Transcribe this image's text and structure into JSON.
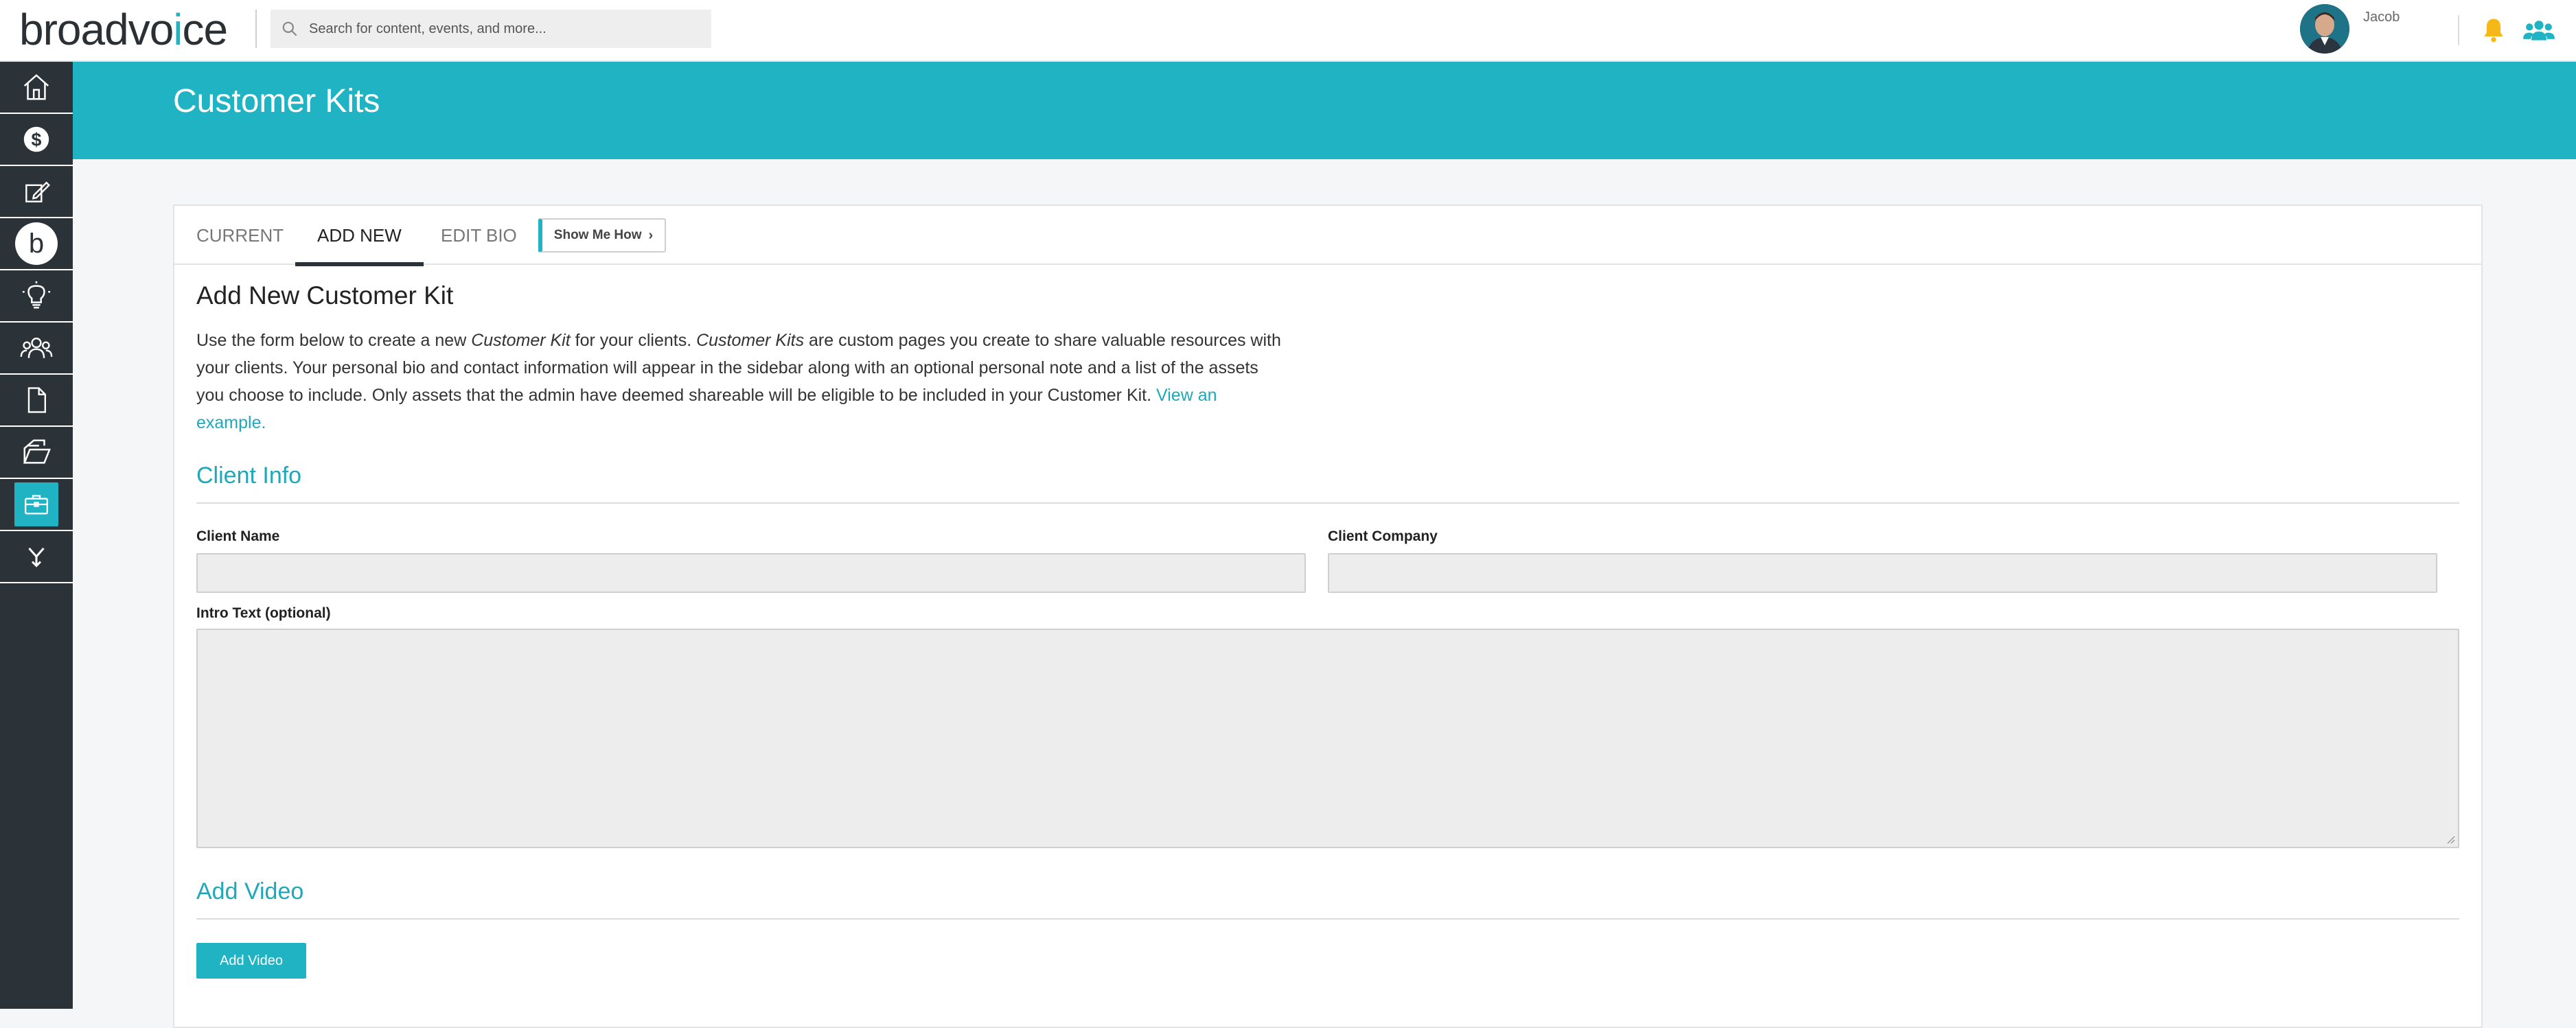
{
  "brand": {
    "logo_pre": "broadvo",
    "logo_accent": "i",
    "logo_post": "ce",
    "accent_color": "#1fb3c4",
    "sidebar_color": "#2b3238"
  },
  "search": {
    "placeholder": "Search for content, events, and more..."
  },
  "user": {
    "name": "Jacob"
  },
  "sidebar": {
    "items": [
      {
        "icon": "home-icon"
      },
      {
        "icon": "dollar-icon"
      },
      {
        "icon": "edit-icon"
      },
      {
        "icon": "b-logo-icon",
        "label": "b"
      },
      {
        "icon": "lightbulb-icon"
      },
      {
        "icon": "people-icon"
      },
      {
        "icon": "document-icon"
      },
      {
        "icon": "folder-icon"
      },
      {
        "icon": "briefcase-icon",
        "active": true
      },
      {
        "icon": "merge-icon"
      }
    ]
  },
  "page": {
    "title": "Customer Kits"
  },
  "tabs": [
    {
      "label": "CURRENT"
    },
    {
      "label": "ADD NEW",
      "active": true
    },
    {
      "label": "EDIT BIO"
    }
  ],
  "show_me_how": {
    "label": "Show Me How",
    "chevron": "›"
  },
  "form": {
    "heading": "Add New Customer Kit",
    "intro": {
      "part1": "Use the form below to create a new ",
      "em1": "Customer Kit",
      "part2": " for your clients. ",
      "em2": "Customer Kits",
      "part3": " are custom pages you create to share valuable resources with your clients. Your personal bio and contact information will appear in the sidebar along with an optional personal note and a list of the assets you choose to include. Only assets that the admin have deemed shareable will be eligible to be included in your Customer Kit. ",
      "link": "View an example."
    },
    "client_info": {
      "title": "Client Info",
      "client_name_label": "Client Name",
      "client_name_value": "",
      "client_company_label": "Client Company",
      "client_company_value": "",
      "intro_text_label": "Intro Text (optional)",
      "intro_text_value": ""
    },
    "video": {
      "title": "Add Video",
      "button_label": "Add Video"
    }
  }
}
